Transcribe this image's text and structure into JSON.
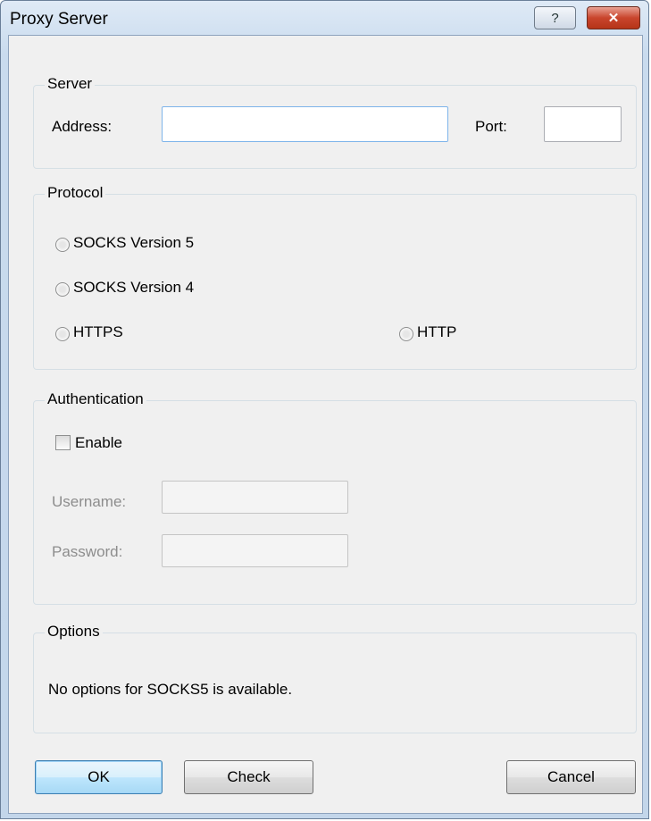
{
  "window": {
    "title": "Proxy Server",
    "help_label": "?",
    "close_label": "✕"
  },
  "server": {
    "legend": "Server",
    "address_label": "Address:",
    "address_value": "",
    "port_label": "Port:",
    "port_value": ""
  },
  "protocol": {
    "legend": "Protocol",
    "options": [
      "SOCKS Version 5",
      "SOCKS Version 4",
      "HTTPS",
      "HTTP"
    ]
  },
  "authentication": {
    "legend": "Authentication",
    "enable_label": "Enable",
    "enable_checked": false,
    "username_label": "Username:",
    "username_value": "",
    "password_label": "Password:",
    "password_value": ""
  },
  "options": {
    "legend": "Options",
    "message": "No options for SOCKS5 is available."
  },
  "buttons": {
    "ok": "OK",
    "check": "Check",
    "cancel": "Cancel"
  }
}
